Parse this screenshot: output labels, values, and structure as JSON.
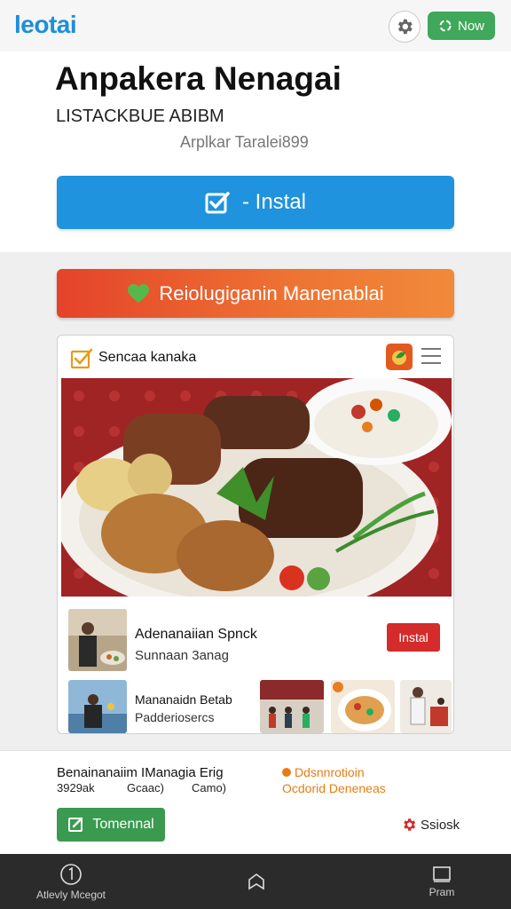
{
  "header": {
    "logo": "leotai",
    "now_label": "Now"
  },
  "app": {
    "title": "Anpakera Nenagai",
    "subtitle": "LISTACKBUE ABIBM",
    "author": "Arplkar Taralei899",
    "install_label": "- Instal"
  },
  "promo": {
    "label": "Reiolugiganin Manenablai"
  },
  "card": {
    "title": "Sencaa kanaka",
    "row1": {
      "title": "Adenanaiian Spnck",
      "subtitle": "Sunnaan 3anag",
      "install_label": "Instal"
    },
    "row2": {
      "title": "Mananaidn Betab",
      "subtitle": "Padderiosercs"
    }
  },
  "bottom": {
    "title": "Benainanaiim IManagia Erig",
    "stats": [
      "3929ak",
      "Gcaac)",
      "Camo)"
    ],
    "right_line1": "Ddsnnrotioin",
    "right_line2": "Ocdorid Deneneas",
    "tomennal_label": "Tomennal",
    "ssiek_label": "Ssiosk"
  },
  "nav": {
    "items": [
      {
        "label": "Atlevly Mcegot",
        "icon": "circle-one-icon"
      },
      {
        "label": "",
        "icon": "home-icon"
      },
      {
        "label": "Pram",
        "icon": "square-icon"
      }
    ]
  },
  "colors": {
    "accent_blue": "#1f93dd",
    "green": "#3fa85a",
    "promo_orange": "#ee7433",
    "red": "#d42b2b"
  }
}
